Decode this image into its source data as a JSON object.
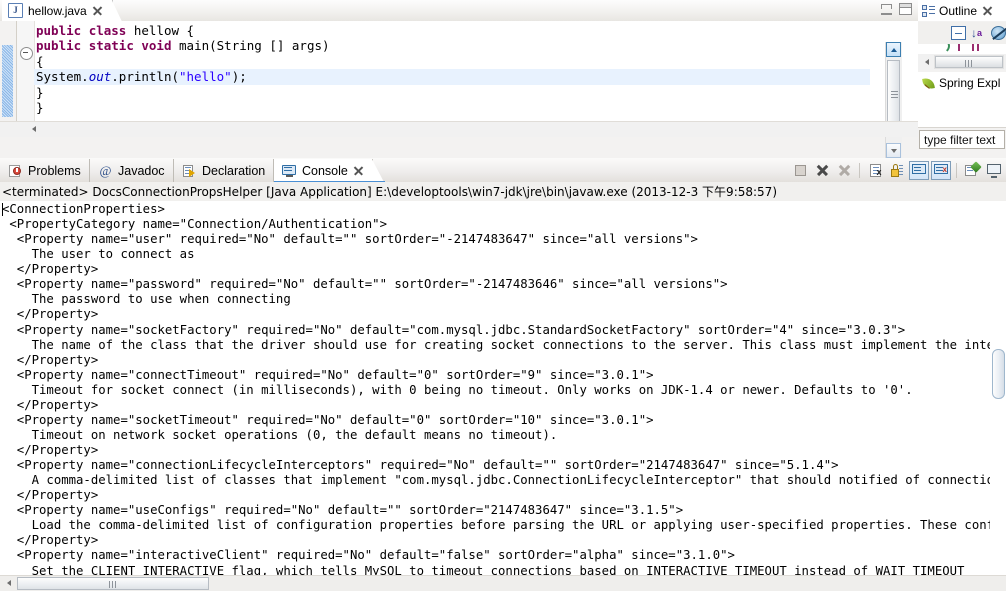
{
  "editor": {
    "tab": {
      "label": "hellow.java",
      "icon": "java-file-icon",
      "badge": "J",
      "close_icon": "close-icon"
    },
    "window_controls": {
      "minimize": "minimize-icon",
      "maximize": "maximize-icon"
    },
    "code_lines": [
      {
        "indent": 0,
        "tokens": [
          {
            "t": "public ",
            "c": "kw"
          },
          {
            "t": "class ",
            "c": "kw"
          },
          {
            "t": "hellow {",
            "c": ""
          }
        ],
        "highlight": false
      },
      {
        "indent": 0,
        "tokens": [
          {
            "t": "public ",
            "c": "kw"
          },
          {
            "t": "static ",
            "c": "kw"
          },
          {
            "t": "void ",
            "c": "kw"
          },
          {
            "t": "main(String [] args)",
            "c": ""
          }
        ],
        "highlight": false
      },
      {
        "indent": 0,
        "tokens": [
          {
            "t": "{",
            "c": ""
          }
        ],
        "highlight": false
      },
      {
        "indent": 0,
        "tokens": [
          {
            "t": "System.",
            "c": ""
          },
          {
            "t": "out",
            "c": "fld"
          },
          {
            "t": ".println(",
            "c": ""
          },
          {
            "t": "\"hello\"",
            "c": "str"
          },
          {
            "t": ");",
            "c": ""
          }
        ],
        "highlight": true
      },
      {
        "indent": 0,
        "tokens": [
          {
            "t": "}",
            "c": ""
          }
        ],
        "highlight": false
      },
      {
        "indent": 0,
        "tokens": [
          {
            "t": "}",
            "c": ""
          }
        ],
        "highlight": false
      }
    ],
    "plain_code": "public class hellow {\npublic static void main(String [] args)\n{\nSystem.out.println(\"hello\");\n}\n}"
  },
  "outline": {
    "tab_label": "Outline",
    "icon": "outline-icon",
    "close_icon": "close-icon",
    "tools": [
      {
        "name": "collapse-all-button",
        "label": "Collapse All"
      },
      {
        "name": "sort-button",
        "label": "Sort"
      },
      {
        "name": "hide-fields-button",
        "label": "Hide Fields"
      }
    ]
  },
  "spring_explorer": {
    "tab_label": "Spring Expl",
    "icon": "spring-leaf-icon",
    "filter_placeholder": "type filter text",
    "filter_value": "type filter text"
  },
  "bottom_view": {
    "tabs": [
      {
        "label": "Problems",
        "icon": "problems-icon",
        "active": false,
        "closable": false
      },
      {
        "label": "Javadoc",
        "icon": "javadoc-at-icon",
        "active": false,
        "closable": false
      },
      {
        "label": "Declaration",
        "icon": "declaration-icon",
        "active": false,
        "closable": false
      },
      {
        "label": "Console",
        "icon": "console-icon",
        "active": true,
        "closable": true
      }
    ],
    "toolbar": [
      {
        "name": "terminate-button",
        "icon": "stop-square-icon",
        "enabled": true
      },
      {
        "name": "remove-launch-button",
        "icon": "remove-x-icon",
        "enabled": true
      },
      {
        "name": "remove-all-terminated-button",
        "icon": "remove-all-x-icon",
        "enabled": false
      },
      {
        "name": "clear-console-button",
        "icon": "clear-console-icon",
        "enabled": true
      },
      {
        "name": "scroll-lock-button",
        "icon": "lock-icon",
        "enabled": true
      },
      {
        "name": "show-console-on-output-button",
        "icon": "console-out-icon",
        "pressed": true
      },
      {
        "name": "show-console-on-error-button",
        "icon": "console-err-icon",
        "pressed": true
      },
      {
        "name": "pin-console-button",
        "icon": "pin-icon",
        "enabled": true
      },
      {
        "name": "display-selected-console-button",
        "icon": "display-console-icon",
        "enabled": true
      }
    ],
    "status_line": "<terminated> DocsConnectionPropsHelper [Java Application] E:\\developtools\\win7-jdk\\jre\\bin\\javaw.exe (2013-12-3 下午9:58:57)",
    "console_output": "<ConnectionProperties>\n <PropertyCategory name=\"Connection/Authentication\">\n  <Property name=\"user\" required=\"No\" default=\"\" sortOrder=\"-2147483647\" since=\"all versions\">\n    The user to connect as\n  </Property>\n  <Property name=\"password\" required=\"No\" default=\"\" sortOrder=\"-2147483646\" since=\"all versions\">\n    The password to use when connecting\n  </Property>\n  <Property name=\"socketFactory\" required=\"No\" default=\"com.mysql.jdbc.StandardSocketFactory\" sortOrder=\"4\" since=\"3.0.3\">\n    The name of the class that the driver should use for creating socket connections to the server. This class must implement the interface 'com\n  </Property>\n  <Property name=\"connectTimeout\" required=\"No\" default=\"0\" sortOrder=\"9\" since=\"3.0.1\">\n    Timeout for socket connect (in milliseconds), with 0 being no timeout. Only works on JDK-1.4 or newer. Defaults to '0'.\n  </Property>\n  <Property name=\"socketTimeout\" required=\"No\" default=\"0\" sortOrder=\"10\" since=\"3.0.1\">\n    Timeout on network socket operations (0, the default means no timeout).\n  </Property>\n  <Property name=\"connectionLifecycleInterceptors\" required=\"No\" default=\"\" sortOrder=\"2147483647\" since=\"5.1.4\">\n    A comma-delimited list of classes that implement \"com.mysql.jdbc.ConnectionLifecycleInterceptor\" that should notified of connection lifecyc\n  </Property>\n  <Property name=\"useConfigs\" required=\"No\" default=\"\" sortOrder=\"2147483647\" since=\"3.1.5\">\n    Load the comma-delimited list of configuration properties before parsing the URL or applying user-specified properties. These configuration\n  </Property>\n  <Property name=\"interactiveClient\" required=\"No\" default=\"false\" sortOrder=\"alpha\" since=\"3.1.0\">\n    Set the CLIENT_INTERACTIVE flag, which tells MySQL to timeout connections based on INTERACTIVE_TIMEOUT instead of WAIT_TIMEOUT"
  },
  "colors": {
    "keyword": "#7f0055",
    "string": "#2a00ff",
    "field": "#0000c0",
    "selection": "#e8f2fe",
    "tab_underline": "#4a8fd4"
  }
}
